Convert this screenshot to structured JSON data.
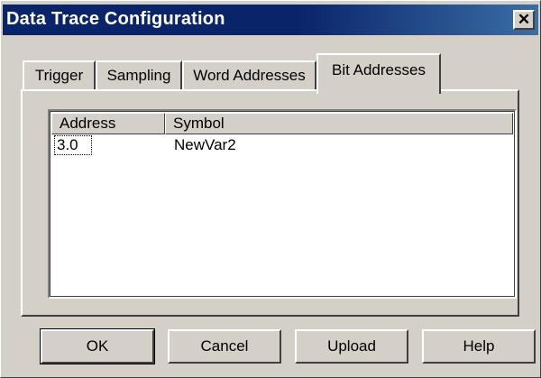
{
  "window": {
    "title": "Data Trace Configuration",
    "close_glyph": "✕"
  },
  "tabs": [
    {
      "label": "Trigger",
      "selected": false
    },
    {
      "label": "Sampling",
      "selected": false
    },
    {
      "label": "Word Addresses",
      "selected": false
    },
    {
      "label": "Bit Addresses",
      "selected": true
    }
  ],
  "list": {
    "columns": [
      "Address",
      "Symbol"
    ],
    "rows": [
      {
        "address": "3.0",
        "symbol": "NewVar2"
      }
    ]
  },
  "buttons": {
    "ok": "OK",
    "cancel": "Cancel",
    "upload": "Upload",
    "help": "Help"
  }
}
